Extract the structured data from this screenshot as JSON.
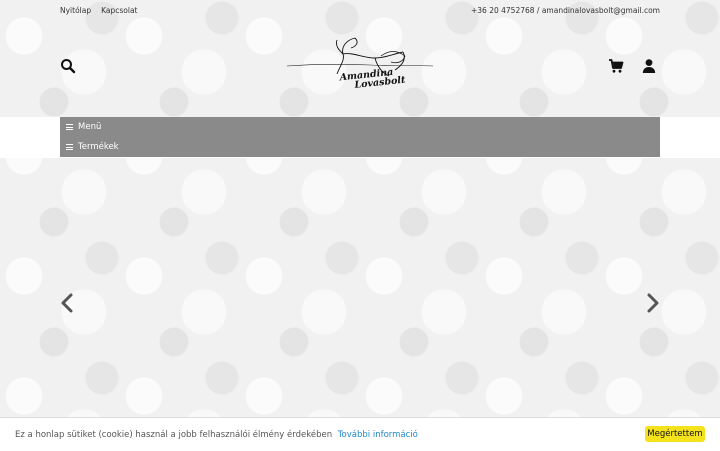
{
  "topbar": {
    "links": [
      {
        "label": "Nyitólap"
      },
      {
        "label": "Kapcsolat"
      }
    ],
    "contact": "+36 20 4752768 / amandinalovasbolt@gmail.com"
  },
  "header": {
    "logo_line1": "Amandina",
    "logo_line2": "Lovasbolt",
    "icons": {
      "search": "search-icon",
      "cart": "cart-icon",
      "user": "user-icon"
    }
  },
  "nav": {
    "menu_label": "Menü",
    "products_label": "Termékek"
  },
  "slider": {
    "prev_icon": "chevron-left-icon",
    "next_icon": "chevron-right-icon"
  },
  "cookie": {
    "text": "Ez a honlap sütiket (cookie) használ a jobb felhasználói élmény érdekében",
    "more_link": "További információ",
    "accept_button": "Megértettem"
  },
  "colors": {
    "nav_bg": "#8a8a8a",
    "cookie_button": "#f4e21d",
    "link": "#1e88c8"
  }
}
